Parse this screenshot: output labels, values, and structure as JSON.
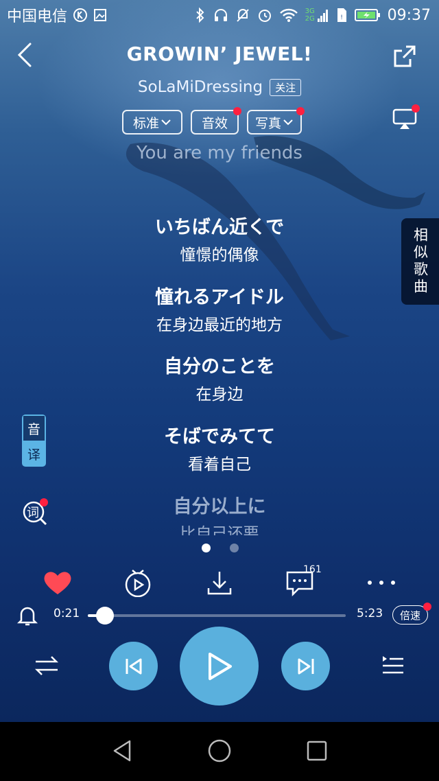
{
  "status_bar": {
    "carrier": "中国电信",
    "network": "3G 2G",
    "time": "09:37"
  },
  "header": {
    "title": "GROWIN’ JEWEL!",
    "artist": "SoLaMiDressing",
    "follow_label": "关注"
  },
  "pills": [
    {
      "label": "标准",
      "has_dropdown": true,
      "has_dot": false
    },
    {
      "label": "音效",
      "has_dropdown": false,
      "has_dot": true
    },
    {
      "label": "写真",
      "has_dropdown": true,
      "has_dot": true
    }
  ],
  "lyrics": {
    "prev_line": "You are my friends",
    "lines": [
      {
        "jp": "いちばん近くで",
        "cn": "憧憬的偶像"
      },
      {
        "jp": "憧れるアイドル",
        "cn": "在身边最近的地方"
      },
      {
        "jp": "自分のことを",
        "cn": "在身边"
      },
      {
        "jp": "そばでみてて",
        "cn": "看着自己"
      },
      {
        "jp": "自分以上に",
        "cn": "比自己还要"
      }
    ]
  },
  "similar_songs_label": "相似歌曲",
  "translation_toggle": {
    "top": "音",
    "bottom": "译"
  },
  "lyric_button_label": "词",
  "actions": {
    "comment_count": "161"
  },
  "progress": {
    "current": "0:21",
    "total": "5:23",
    "fraction": 0.066
  },
  "speed_label": "倍速",
  "colors": {
    "accent": "#5ab0dd",
    "heart": "#ff4a55",
    "badge_dot": "#ff2040"
  }
}
